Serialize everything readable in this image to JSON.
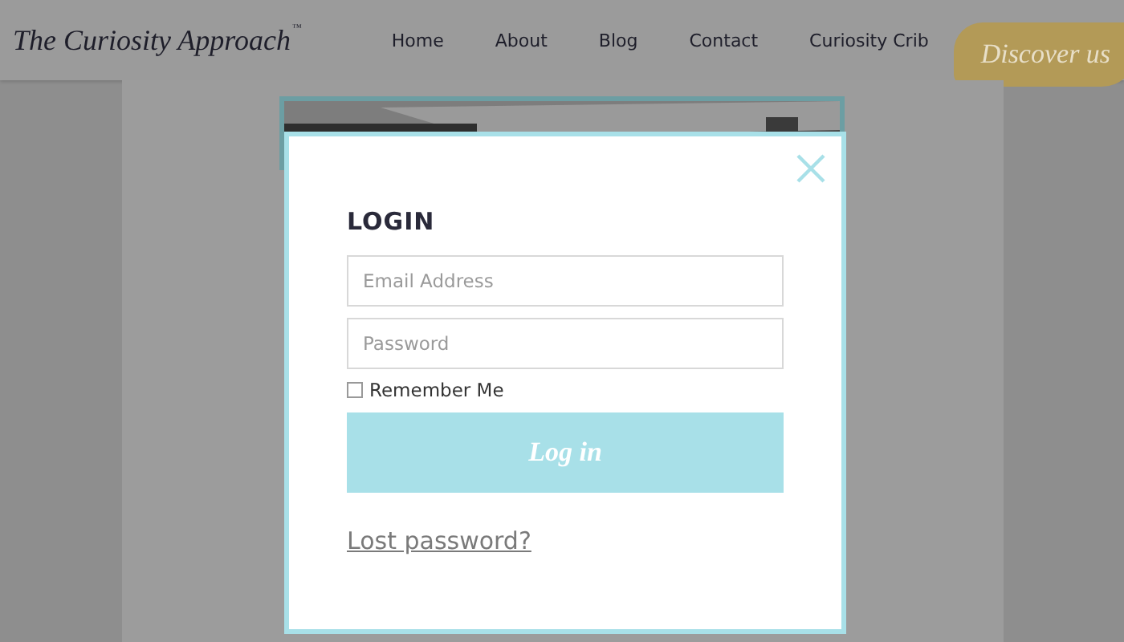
{
  "header": {
    "logo": "The Curiosity Approach",
    "logo_mark": "™",
    "nav": [
      {
        "label": "Home"
      },
      {
        "label": "About"
      },
      {
        "label": "Blog"
      },
      {
        "label": "Contact"
      },
      {
        "label": "Curiosity Crib"
      }
    ],
    "cta": "Discover us"
  },
  "modal": {
    "title": "LOGIN",
    "email": {
      "placeholder": "Email Address"
    },
    "password": {
      "placeholder": "Password"
    },
    "remember": {
      "label": "Remember Me",
      "checked": false
    },
    "submit": "Log in",
    "lost_password": "Lost password?"
  }
}
